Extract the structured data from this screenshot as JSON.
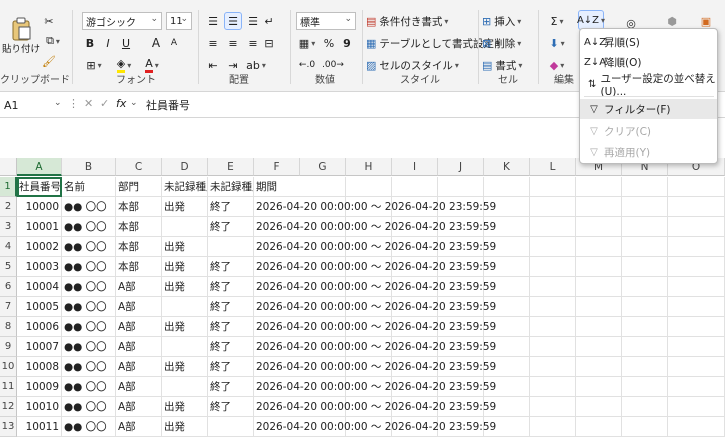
{
  "ribbon": {
    "clipboard": {
      "paste": "貼り付け",
      "label": "クリップボード"
    },
    "font": {
      "name": "游ゴシック",
      "size": "11",
      "bold": "B",
      "italic": "I",
      "underline": "U",
      "grow": "A",
      "shrink": "A",
      "label": "フォント"
    },
    "alignment": {
      "label": "配置"
    },
    "number": {
      "format": "標準",
      "percent": "%",
      "comma": "9",
      "label": "数値"
    },
    "styles": {
      "conditional": "条件付き書式",
      "table": "テーブルとして書式設定",
      "cell": "セルのスタイル",
      "label": "スタイル"
    },
    "cells": {
      "insert": "挿入",
      "delete": "削除",
      "format": "書式",
      "label": "セル"
    },
    "editing": {
      "sigma": "Σ",
      "label": "編集"
    }
  },
  "sort_menu": {
    "items": [
      {
        "label": "昇順(S)",
        "icon": "sort-asc-icon",
        "enabled": true
      },
      {
        "label": "降順(O)",
        "icon": "sort-desc-icon",
        "enabled": true
      },
      {
        "label": "ユーザー設定の並べ替え(U)...",
        "icon": "custom-sort-icon",
        "enabled": true
      },
      {
        "label": "フィルター(F)",
        "icon": "filter-icon",
        "enabled": true
      },
      {
        "label": "クリア(C)",
        "icon": "clear-filter-icon",
        "enabled": false
      },
      {
        "label": "再適用(Y)",
        "icon": "reapply-icon",
        "enabled": false
      }
    ]
  },
  "formula_bar": {
    "name_box": "A1",
    "fx": "fx",
    "content": "社員番号"
  },
  "columns": [
    "A",
    "B",
    "C",
    "D",
    "E",
    "F",
    "G",
    "H",
    "I",
    "J",
    "K",
    "L",
    "M",
    "N",
    "O"
  ],
  "rows": [
    {
      "num": "1",
      "a": "社員番号",
      "b": "名前",
      "c": "部門",
      "d": "未記録種別",
      "e": "未記録種別",
      "f": "期間"
    },
    {
      "num": "2",
      "a": "10000",
      "b": "●● 〇〇",
      "c": "本部",
      "d": "出発",
      "e": "終了",
      "f": "2026-04-20 00:00:00 ～ 2026-04-20 23:59:59"
    },
    {
      "num": "3",
      "a": "10001",
      "b": "●● 〇〇",
      "c": "本部",
      "d": "",
      "e": "終了",
      "f": "2026-04-20 00:00:00 ～ 2026-04-20 23:59:59"
    },
    {
      "num": "4",
      "a": "10002",
      "b": "●● 〇〇",
      "c": "本部",
      "d": "出発",
      "e": "",
      "f": "2026-04-20 00:00:00 ～ 2026-04-20 23:59:59"
    },
    {
      "num": "5",
      "a": "10003",
      "b": "●● 〇〇",
      "c": "本部",
      "d": "出発",
      "e": "終了",
      "f": "2026-04-20 00:00:00 ～ 2026-04-20 23:59:59"
    },
    {
      "num": "6",
      "a": "10004",
      "b": "●● 〇〇",
      "c": "A部",
      "d": "出発",
      "e": "終了",
      "f": "2026-04-20 00:00:00 ～ 2026-04-20 23:59:59"
    },
    {
      "num": "7",
      "a": "10005",
      "b": "●● 〇〇",
      "c": "A部",
      "d": "",
      "e": "終了",
      "f": "2026-04-20 00:00:00 ～ 2026-04-20 23:59:59"
    },
    {
      "num": "8",
      "a": "10006",
      "b": "●● 〇〇",
      "c": "A部",
      "d": "出発",
      "e": "終了",
      "f": "2026-04-20 00:00:00 ～ 2026-04-20 23:59:59"
    },
    {
      "num": "9",
      "a": "10007",
      "b": "●● 〇〇",
      "c": "A部",
      "d": "",
      "e": "終了",
      "f": "2026-04-20 00:00:00 ～ 2026-04-20 23:59:59"
    },
    {
      "num": "10",
      "a": "10008",
      "b": "●● 〇〇",
      "c": "A部",
      "d": "出発",
      "e": "終了",
      "f": "2026-04-20 00:00:00 ～ 2026-04-20 23:59:59"
    },
    {
      "num": "11",
      "a": "10009",
      "b": "●● 〇〇",
      "c": "A部",
      "d": "",
      "e": "終了",
      "f": "2026-04-20 00:00:00 ～ 2026-04-20 23:59:59"
    },
    {
      "num": "12",
      "a": "10010",
      "b": "●● 〇〇",
      "c": "A部",
      "d": "出発",
      "e": "終了",
      "f": "2026-04-20 00:00:00 ～ 2026-04-20 23:59:59"
    },
    {
      "num": "13",
      "a": "10011",
      "b": "●● 〇〇",
      "c": "A部",
      "d": "出発",
      "e": "",
      "f": "2026-04-20 00:00:00 ～ 2026-04-20 23:59:59"
    }
  ],
  "colors": {
    "accent": "#217346",
    "menu_highlight": "#e8e8e8"
  }
}
